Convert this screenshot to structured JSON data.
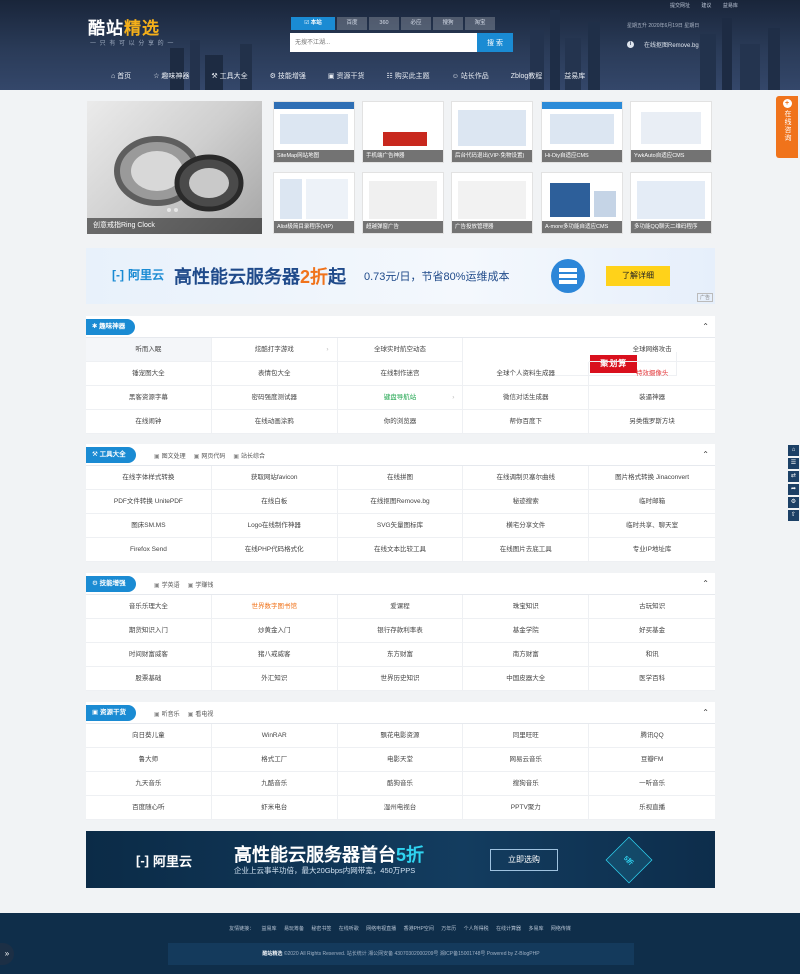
{
  "header": {
    "logo_main": "酷站",
    "logo_accent": "精选",
    "slogan": "一 只 有 可 以 分 享 的 一",
    "toplinks": [
      "提交网址",
      "建议",
      "益易库"
    ],
    "date_text": "星期五升  2020年6月19日 星期日",
    "info_text": "在线抠图Remove.bg",
    "search_tabs": [
      "本站",
      "百度",
      "360",
      "必应",
      "搜狗",
      "淘宝"
    ],
    "search_placeholder": "无搜不江湖...",
    "search_button": "搜 索",
    "nav": [
      "首页",
      "趣味神器",
      "工具大全",
      "技能增强",
      "资源干货",
      "购买此主题",
      "站长作品",
      "Zblog教程",
      "益易库"
    ]
  },
  "slider": {
    "caption": "创意戒指Ring Clock"
  },
  "thumbs": [
    "SiteMap网站地图",
    "手机端广告神器",
    "后台代码退出(VIP·免物设置)",
    "Hi-Diy自适应CMS",
    "YwkAuto自适应CMS",
    "Alist极简目录程序(VIP)",
    "超越弹窗广告",
    "广告投放管理器",
    "A-more多功能自适应CMS",
    "多功能QQ聊天二维码程序"
  ],
  "ad1": {
    "brand": "阿里云",
    "title_a": "高性能云服务器",
    "title_b": "2折",
    "title_c": "起",
    "sub": "0.73元/日，节省80%运维成本",
    "button": "了解详细",
    "tag": "广告"
  },
  "sections": [
    {
      "title": "趣味神器",
      "tabs": [],
      "cells": [
        "听而入眠",
        "炫酷打字游戏",
        "全球实时航空动态",
        "聚划算",
        "全球网络攻击",
        "锤宠图大全",
        "表情包大全",
        "在线制作迷宫",
        "全球个人资料生成器",
        "特效摄像头",
        "黑客资源字幕",
        "密码强度测试器",
        "键盘导航站",
        "微信对话生成器",
        "装逼神器",
        "在线闹钟",
        "在线动画涂鸦",
        "你的浏览器",
        "帮你百度下",
        "另类俄罗斯方块"
      ]
    },
    {
      "title": "工具大全",
      "tabs": [
        "图文处理",
        "网页代码",
        "站长综合"
      ],
      "cells": [
        "在线字体样式转换",
        "获取网站favicon",
        "在线拼图",
        "在线调制贝塞尔曲线",
        "图片格式转换 Jinaconvert",
        "PDF文件转换 UnitePDF",
        "在线白板",
        "在线抠图Remove.bg",
        "秘迹搜索",
        "临时邮箱",
        "图床SM.MS",
        "Logo在线制作神器",
        "SVG矢量图标库",
        "横宅分享文件",
        "临时共享、聊天室",
        "Firefox Send",
        "在线PHP代码格式化",
        "在线文本比较工具",
        "在线图片去底工具",
        "专业IP地址库"
      ]
    },
    {
      "title": "技能增强",
      "tabs": [
        "学英语",
        "学赚钱"
      ],
      "cells": [
        "音乐乐理大全",
        "世界数字图书馆",
        "爱课程",
        "珠宝知识",
        "古玩知识",
        "期货知识入门",
        "炒黄金入门",
        "银行存款利率表",
        "基金学院",
        "好买基金",
        "时间财富威客",
        "猪八戒威客",
        "东方财富",
        "南方财富",
        "和讯",
        "股票基础",
        "外汇知识",
        "世界历史知识",
        "中国皮器大全",
        "医学百科"
      ]
    },
    {
      "title": "资源干货",
      "tabs": [
        "听音乐",
        "看电视"
      ],
      "cells": [
        "向日葵儿童",
        "WinRAR",
        "飘花电影资源",
        "同里旺旺",
        "腾讯QQ",
        "鲁大师",
        "格式工厂",
        "电影天堂",
        "网易云音乐",
        "豆瓣FM",
        "九天音乐",
        "九酷音乐",
        "酷狗音乐",
        "搜狗音乐",
        "一听音乐",
        "百度随心听",
        "虾米电台",
        "湿州电视台",
        "PPTV聚力",
        "乐视直播"
      ]
    }
  ],
  "ad2": {
    "brand": "阿里云",
    "title_a": "高性能云服务器首台",
    "title_b": "5折",
    "sub": "企业上云事半功倍，最大20Gbps内网带宽，450万PPS",
    "button": "立即选购",
    "box": "5折"
  },
  "footer": {
    "links": [
      "友情链接：",
      "益易库",
      "易玩筹备",
      "秘密书签",
      "在线听歌",
      "网络电视直播",
      "香港PHP空间",
      "万年历",
      "个人所得税",
      "在线计算器",
      "多易库",
      "网络传媒"
    ],
    "copy_name": "酷站精选",
    "copy_text": "©2020 All Rights Reserved. 站长统计  湘公网安备 43070302000209号  湘ICP备15001748号  Powered by Z-BlogPHP"
  },
  "float_button": {
    "icon": "+",
    "label": "在线咨询"
  },
  "sidetools": [
    "home",
    "list",
    "shuffle",
    "share",
    "settings",
    "top"
  ],
  "colors": {
    "accent": "#1a8bd3",
    "orange": "#f0731b",
    "footer": "#0f2e4a"
  }
}
